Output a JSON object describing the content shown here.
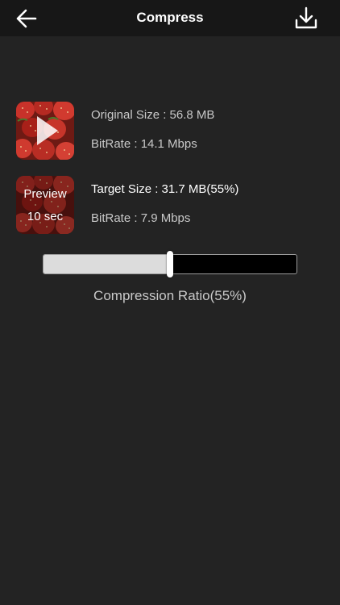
{
  "header": {
    "title": "Compress",
    "back_icon": "arrow-left-icon",
    "download_icon": "download-icon"
  },
  "original": {
    "size_text": "Original Size : 56.8 MB",
    "bitrate_text": "BitRate : 14.1 Mbps",
    "thumb_icon": "play-icon"
  },
  "target": {
    "size_text": "Target Size : 31.7 MB(55%)",
    "bitrate_text": "BitRate : 7.9 Mbps",
    "preview_line1": "Preview",
    "preview_line2": "10 sec"
  },
  "compression": {
    "ratio": 0.5,
    "label": "Compression Ratio(55%)"
  },
  "colors": {
    "background": "#232323",
    "header": "#171717",
    "slider_fill": "#dcdcdc",
    "slider_empty": "#000000"
  }
}
